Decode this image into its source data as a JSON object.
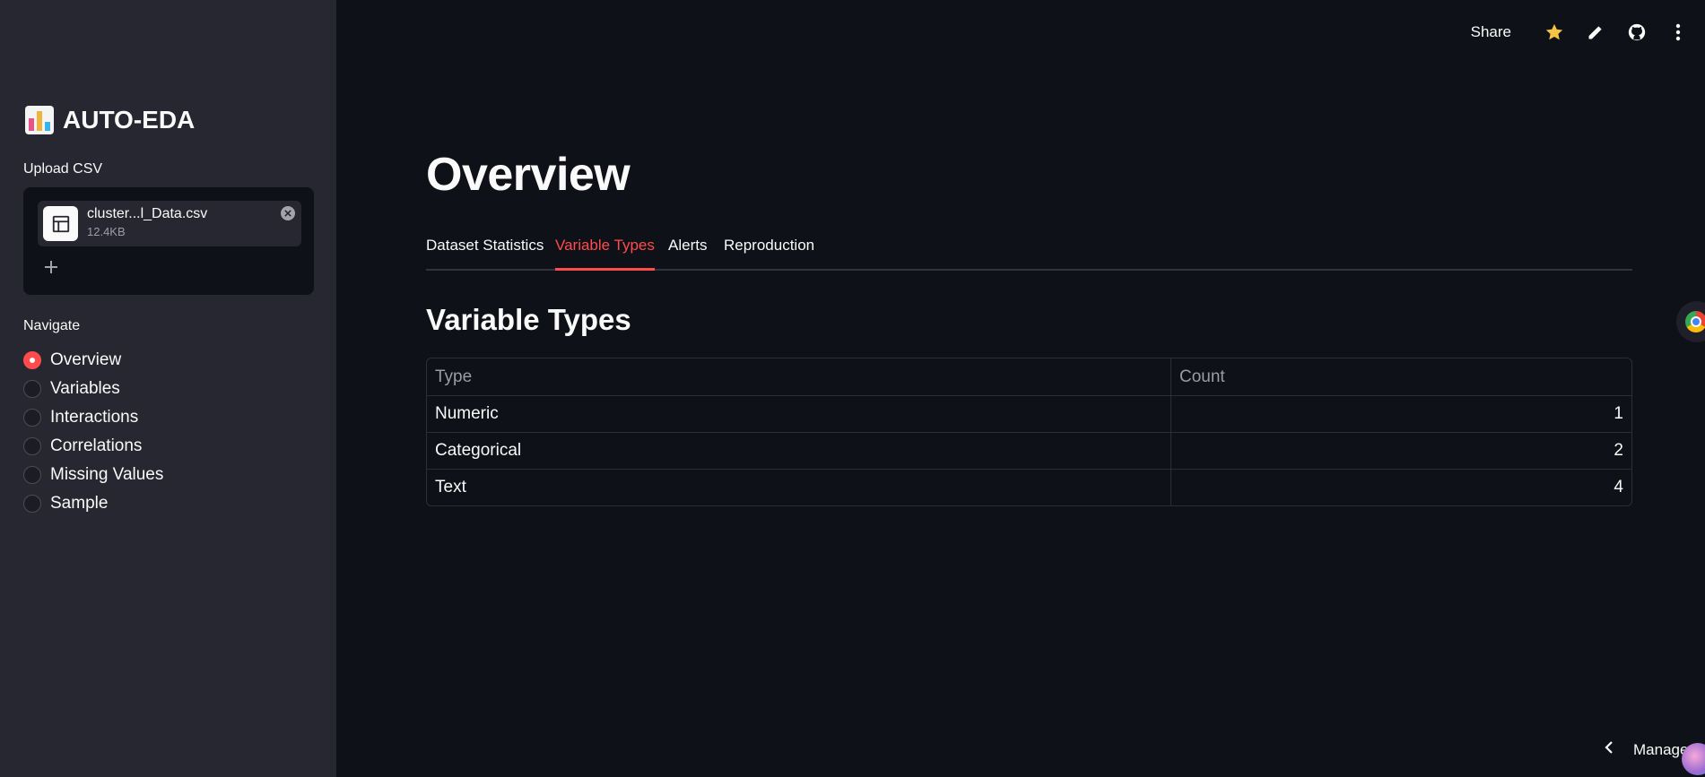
{
  "sidebar": {
    "app_title": "AUTO-EDA",
    "upload_label": "Upload CSV",
    "file": {
      "name": "cluster...l_Data.csv",
      "size": "12.4KB"
    },
    "nav_label": "Navigate",
    "nav_items": [
      {
        "label": "Overview",
        "selected": true
      },
      {
        "label": "Variables",
        "selected": false
      },
      {
        "label": "Interactions",
        "selected": false
      },
      {
        "label": "Correlations",
        "selected": false
      },
      {
        "label": "Missing Values",
        "selected": false
      },
      {
        "label": "Sample",
        "selected": false
      }
    ]
  },
  "toolbar": {
    "share_label": "Share",
    "icons": [
      "star-icon",
      "pencil-icon",
      "github-icon",
      "kebab-menu-icon"
    ]
  },
  "main": {
    "title": "Overview",
    "tabs": [
      {
        "label": "Dataset Statistics",
        "active": false
      },
      {
        "label": "Variable Types",
        "active": true
      },
      {
        "label": "Alerts",
        "active": false
      },
      {
        "label": "Reproduction",
        "active": false
      }
    ],
    "section_title": "Variable Types",
    "table": {
      "columns": [
        "Type",
        "Count"
      ],
      "rows": [
        [
          "Numeric",
          "1"
        ],
        [
          "Categorical",
          "2"
        ],
        [
          "Text",
          "4"
        ]
      ]
    }
  },
  "footer": {
    "manage_label": "Manage a"
  },
  "colors": {
    "accent": "#ff4b4b",
    "background": "#0e1117",
    "sidebar": "#262730",
    "star": "#f6c343"
  }
}
